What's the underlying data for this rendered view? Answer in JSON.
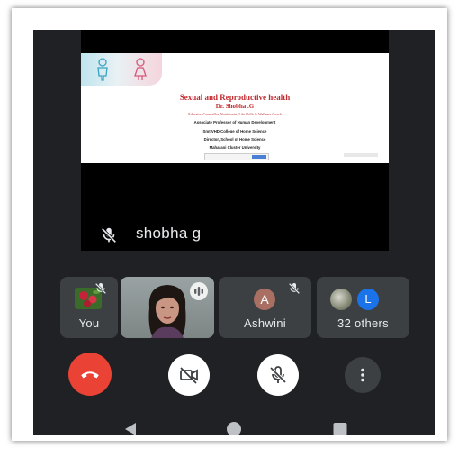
{
  "main": {
    "presenter_name": "shobha g",
    "slide": {
      "title": "Sexual and Reproductive health",
      "author": "Dr. Shobha .G",
      "subtitle": "Educator, Counsellor, Nutritionist, Life Skills & Wellness Coach",
      "lines": [
        "Associate Professor  of Human Development",
        "Smt VHD College of Home Science",
        "Director, School of Home Science",
        "Maharani Cluster University"
      ]
    }
  },
  "participants": {
    "you_label": "You",
    "ashwini_label": "Ashwini",
    "ashwini_initial": "A",
    "others_label": "32 others",
    "others_initial": "L"
  },
  "colors": {
    "background": "#202124",
    "tile": "#3c4043",
    "end_call": "#ea4335",
    "avatar_a": "#a86f62",
    "avatar_l": "#1a73e8"
  },
  "icons": {
    "mic_off": "mic-off-icon",
    "camera_off": "camera-off-icon",
    "end_call": "phone-hangup-icon",
    "more": "more-vert-icon",
    "speaking": "audio-levels-icon",
    "nav_back": "triangle-back-icon",
    "nav_home": "circle-home-icon",
    "nav_recents": "square-recents-icon"
  }
}
